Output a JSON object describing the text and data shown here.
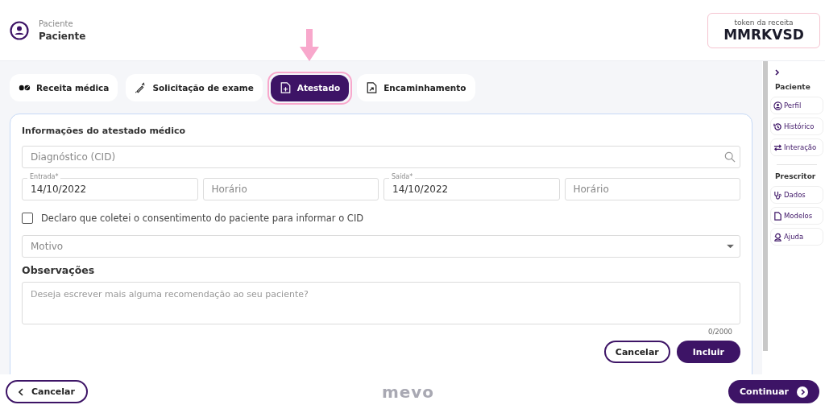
{
  "header": {
    "label": "Paciente",
    "name": "Paciente",
    "token_label": "token da receita",
    "token": "MMRKVSD"
  },
  "tabs": [
    {
      "label": "Receita médica",
      "selected": false
    },
    {
      "label": "Solicitação de exame",
      "selected": false
    },
    {
      "label": "Atestado",
      "selected": true
    },
    {
      "label": "Encaminhamento",
      "selected": false
    }
  ],
  "form": {
    "title": "Informações do atestado médico",
    "diagnosis": {
      "placeholder": "Diagnóstico (CID)"
    },
    "entry": {
      "label": "Entrada*",
      "value": "14/10/2022"
    },
    "entry_time": {
      "placeholder": "Horário"
    },
    "exit": {
      "label": "Saída*",
      "value": "14/10/2022"
    },
    "exit_time": {
      "placeholder": "Horário"
    },
    "consent": {
      "label": "Declaro que coletei o consentimento do paciente para informar o CID",
      "checked": false
    },
    "reason": {
      "placeholder": "Motivo"
    },
    "notes_title": "Observações",
    "notes": {
      "placeholder": "Deseja escrever mais alguma recomendação ao seu paciente?"
    },
    "counter": "0/2000",
    "cancel": "Cancelar",
    "submit": "Incluir"
  },
  "sidebar": {
    "sections": [
      {
        "title": "Paciente",
        "items": [
          {
            "label": "Perfil"
          },
          {
            "label": "Histórico"
          },
          {
            "label": "Interação"
          }
        ]
      },
      {
        "title": "Prescritor",
        "items": [
          {
            "label": "Dados"
          },
          {
            "label": "Modelos"
          },
          {
            "label": "Ajuda"
          }
        ]
      }
    ]
  },
  "footer": {
    "cancel": "Cancelar",
    "logo": "mevo",
    "continue": "Continuar"
  }
}
